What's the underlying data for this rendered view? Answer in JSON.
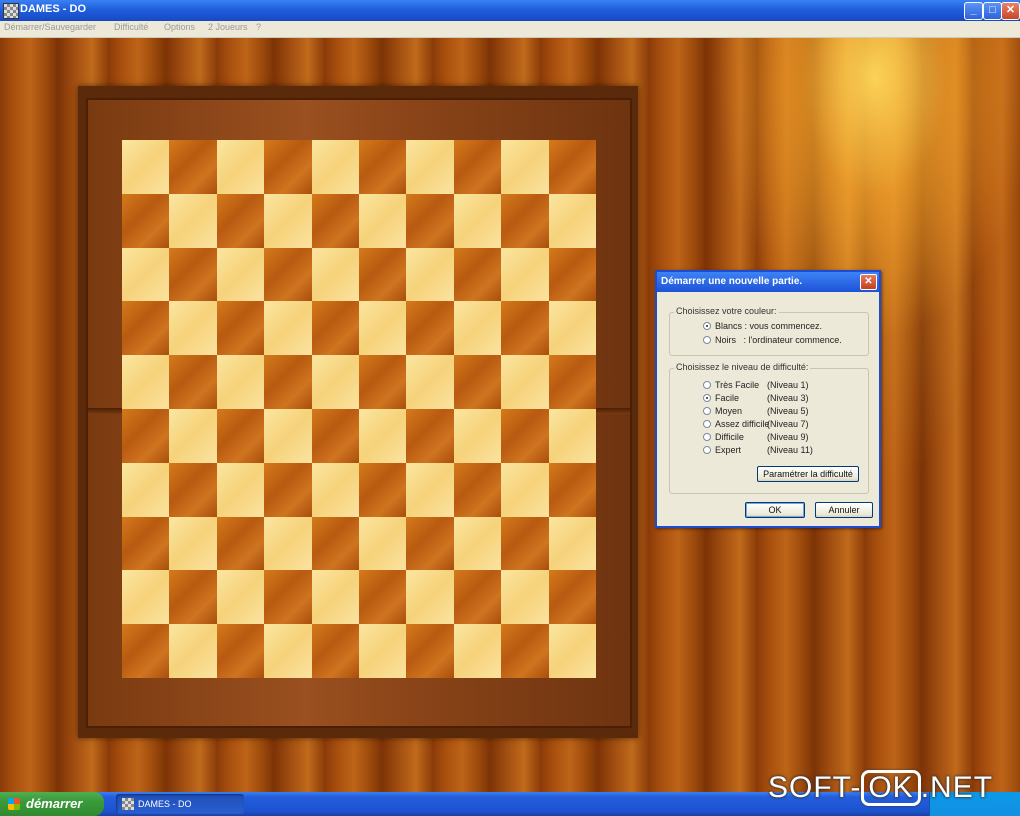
{
  "window": {
    "title": "DAMES - DO",
    "minimize": "_",
    "maximize": "□",
    "close": "✕"
  },
  "menu": [
    "Démarrer/Sauvegarder",
    "Difficulté",
    "Options",
    "2 Joueurs",
    "?"
  ],
  "board": {
    "size": 10
  },
  "dialog": {
    "title": "Démarrer une nouvelle partie.",
    "close": "✕",
    "color_group": {
      "legend": "Choisissez votre couleur:",
      "options": [
        {
          "label": "Blancs : vous commencez.",
          "selected": true
        },
        {
          "label": "Noirs   : l'ordinateur commence.",
          "selected": false
        }
      ]
    },
    "difficulty_group": {
      "legend": "Choisissez le niveau de difficulté:",
      "options": [
        {
          "label": "Très Facile",
          "level": "(Niveau 1)",
          "selected": false
        },
        {
          "label": "Facile",
          "level": "(Niveau 3)",
          "selected": true
        },
        {
          "label": "Moyen",
          "level": "(Niveau 5)",
          "selected": false
        },
        {
          "label": "Assez difficile",
          "level": "(Niveau 7)",
          "selected": false
        },
        {
          "label": "Difficile",
          "level": "(Niveau 9)",
          "selected": false
        },
        {
          "label": "Expert",
          "level": "(Niveau 11)",
          "selected": false
        }
      ],
      "param_button": "Paramétrer la difficulté"
    },
    "ok": "OK",
    "cancel": "Annuler"
  },
  "taskbar": {
    "start": "démarrer",
    "task": "DAMES - DO"
  },
  "watermark": {
    "left": "SOFT-",
    "ok": "OK",
    "right": ".NET"
  }
}
